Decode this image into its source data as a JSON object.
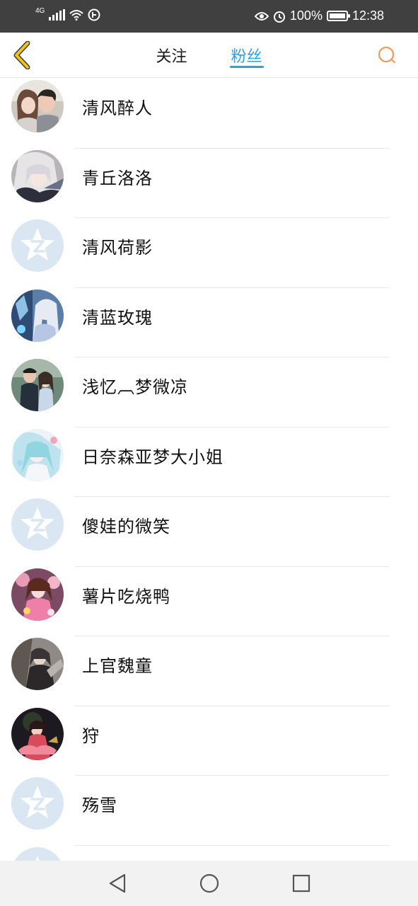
{
  "status_bar": {
    "network_type": "4G",
    "battery_percent": "100%",
    "time": "12:38"
  },
  "header": {
    "tabs": [
      {
        "label": "关注",
        "active": false
      },
      {
        "label": "粉丝",
        "active": true
      }
    ]
  },
  "fans": [
    {
      "name": "清风醉人",
      "avatar": "photo-couple"
    },
    {
      "name": "青丘洛洛",
      "avatar": "photo-anime-white"
    },
    {
      "name": "清风荷影",
      "avatar": "default"
    },
    {
      "name": "清蓝玫瑰",
      "avatar": "photo-anime-blue"
    },
    {
      "name": "浅忆︹梦微凉",
      "avatar": "photo-couple-street"
    },
    {
      "name": "日奈森亚梦大小姐",
      "avatar": "photo-anime-miku"
    },
    {
      "name": "傻娃的微笑",
      "avatar": "default"
    },
    {
      "name": "薯片吃烧鸭",
      "avatar": "photo-anime-pink"
    },
    {
      "name": "上官魏童",
      "avatar": "photo-anime-dark"
    },
    {
      "name": "狩",
      "avatar": "photo-anime-red"
    },
    {
      "name": "殇雪",
      "avatar": "default"
    },
    {
      "name": "",
      "avatar": "default"
    }
  ],
  "colors": {
    "accent": "#2aa1e4",
    "back_icon": "#f0c21a",
    "search_icon": "#f29a5c",
    "default_avatar_bg": "#dbe6f3"
  }
}
